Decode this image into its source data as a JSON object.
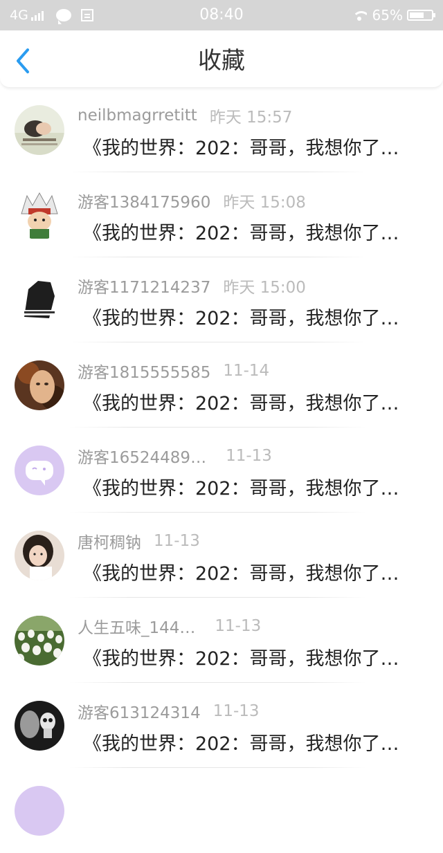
{
  "status_bar": {
    "network": "4G",
    "time": "08:40",
    "battery": "65%",
    "battery_level": 0.65,
    "icons": [
      "signal-icon",
      "chat-icon",
      "notification-box-icon",
      "wifi-icon",
      "battery-icon"
    ]
  },
  "header": {
    "back_icon": "back-chevron-icon",
    "title": "收藏",
    "accent_color": "#2a9cf0"
  },
  "favorites": [
    {
      "user": "neilbmagrretitt",
      "time": "昨天 15:57",
      "text": "《我的世界：202：哥哥，我想你了…",
      "avatar": "avatar-girl-sleeping"
    },
    {
      "user": "游客1384175960",
      "time": "昨天 15:08",
      "text": "《我的世界：202：哥哥，我想你了…",
      "avatar": "avatar-cartoon-ninja"
    },
    {
      "user": "游客1171214237",
      "time": "昨天 15:00",
      "text": "《我的世界：202：哥哥，我想你了…",
      "avatar": "avatar-dark-figure"
    },
    {
      "user": "游客1815555585",
      "time": "11-14",
      "text": "《我的世界：202：哥哥，我想你了…",
      "avatar": "avatar-portrait-woman"
    },
    {
      "user": "游客16524489…",
      "time": "11-13",
      "text": "《我的世界：202：哥哥，我想你了…",
      "avatar": "avatar-default-chat"
    },
    {
      "user": "唐柯稠钠",
      "time": "11-13",
      "text": "《我的世界：202：哥哥，我想你了…",
      "avatar": "avatar-girl-photo"
    },
    {
      "user": "人生五味_144…",
      "time": "11-13",
      "text": "《我的世界：202：哥哥，我想你了…",
      "avatar": "avatar-tulips"
    },
    {
      "user": "游客613124314",
      "time": "11-13",
      "text": "《我的世界：202：哥哥，我想你了…",
      "avatar": "avatar-skull"
    }
  ]
}
